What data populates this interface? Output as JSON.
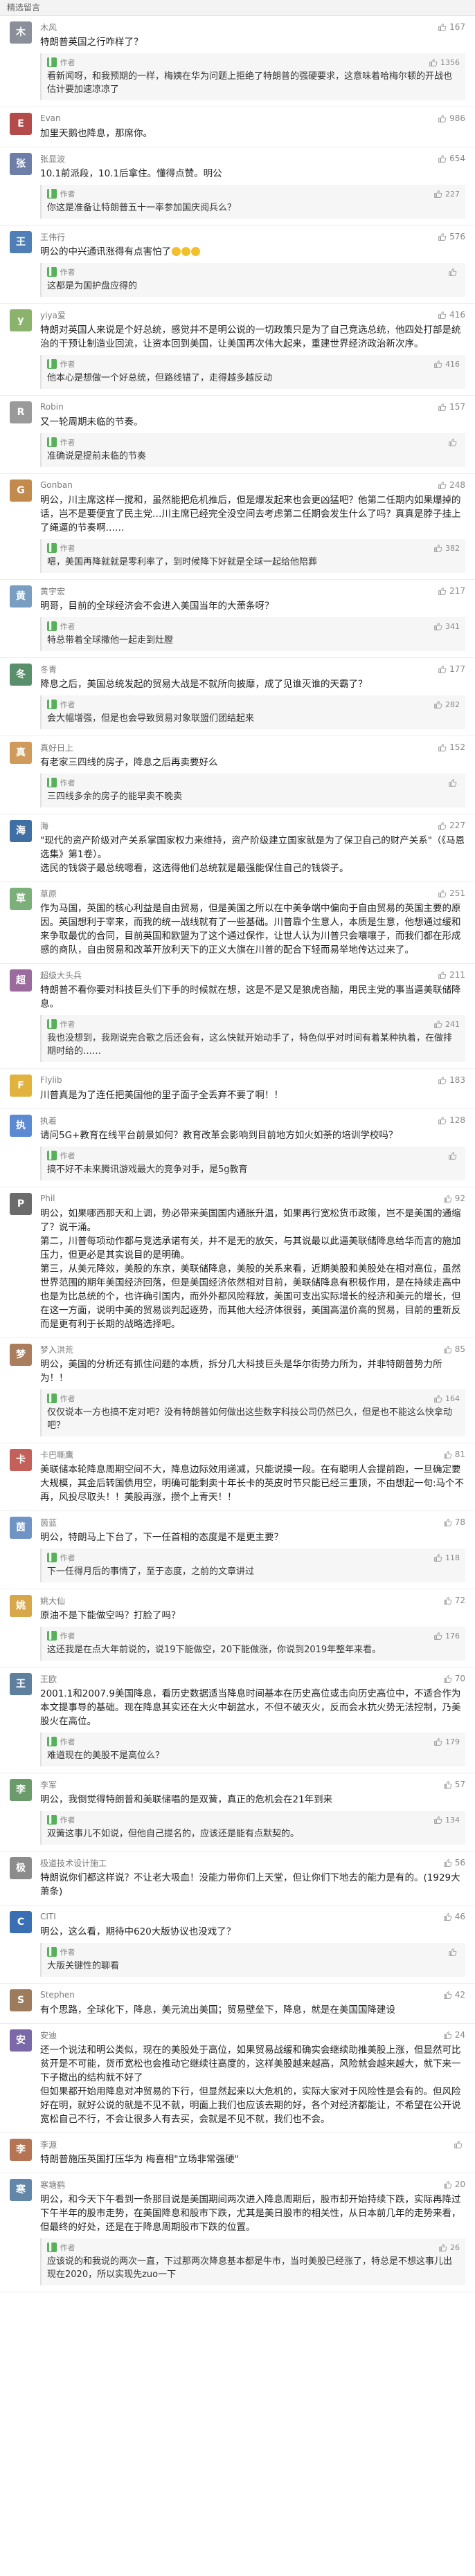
{
  "header": {
    "title": "精选留言"
  },
  "comments": [
    {
      "nickname": "木风",
      "avatar_color": "#8a8f99",
      "avatar_char": "木",
      "likes": "167",
      "content": "特朗普英国之行咋样了？",
      "reply": {
        "author_label": "作者",
        "likes": "1356",
        "text": "看新闻呀，和我预期的一样，梅姨在华为问题上拒绝了特朗普的强硬要求，这意味着哈梅尔顿的开战也估计要加速凉凉了"
      }
    },
    {
      "nickname": "Evan",
      "avatar_color": "#b44b4b",
      "avatar_char": "E",
      "likes": "986",
      "content": "加里天鹅也降息，那席你。",
      "reply": null
    },
    {
      "nickname": "张显波",
      "avatar_color": "#6d7fa8",
      "avatar_char": "张",
      "likes": "654",
      "content": "10.1前派段，10.1后拿住。懂得点赞。明公",
      "reply": {
        "author_label": "作者",
        "likes": "227",
        "text": "你这是准备让特朗普五十一率参加国庆阅兵么？"
      }
    },
    {
      "nickname": "王伟行",
      "avatar_color": "#4f7fb6",
      "avatar_char": "王",
      "likes": "576",
      "content": "明公的中兴通讯涨得有点害怕了",
      "emoji_count": 3,
      "reply": {
        "author_label": "作者",
        "likes": "",
        "text": "这都是为国护盘应得的"
      }
    },
    {
      "nickname": "yiya爱",
      "avatar_color": "#8bb36b",
      "avatar_char": "y",
      "likes": "416",
      "content": "特朗对英国人来说是个好总统，感觉并不是明公说的一切政策只是为了自己竞选总统，他四处打部是统治的干预让制造业回流，让资本回到美国，让美国再次伟大起来，重建世界经济政治新次序。",
      "reply": {
        "author_label": "作者",
        "likes": "416",
        "text": "他本心是想做一个好总统，但路线错了，走得越多越反动"
      }
    },
    {
      "nickname": "Robin",
      "avatar_color": "#9a9a9a",
      "avatar_char": "R",
      "likes": "157",
      "content": "又一轮周期未临的节奏。",
      "reply": {
        "author_label": "作者",
        "likes": "",
        "text": "准确说是提前未临的节奏"
      }
    },
    {
      "nickname": "Gonban",
      "avatar_color": "#c28a4d",
      "avatar_char": "G",
      "likes": "248",
      "content": "明公，川主席这样一搅和，虽然能把危机推后，但是爆发起来也会更凶猛吧？他第二任期内如果爆掉的话，岂不是要便宜了民主党…川主席已经完全没空间去考虑第二任期会发生什么了吗？真真是脖子挂上了绳逼的节奏啊……",
      "reply": {
        "author_label": "作者",
        "likes": "382",
        "text": "嗯，美国再降就就是零利率了，到时候降下好就是全球一起给他陪葬"
      }
    },
    {
      "nickname": "黄宇宏",
      "avatar_color": "#7a9ec2",
      "avatar_char": "黄",
      "likes": "217",
      "content": "明哥，目前的全球经济会不会进入美国当年的大萧条呀？",
      "reply": {
        "author_label": "作者",
        "likes": "341",
        "text": "特总带着全球撒他一起走到灶膛"
      }
    },
    {
      "nickname": "冬青",
      "avatar_color": "#5a8f6c",
      "avatar_char": "冬",
      "likes": "177",
      "content": "降息之后，美国总统发起的贸易大战是不就所向披靡，成了见谁灭谁的天霸了？",
      "reply": {
        "author_label": "作者",
        "likes": "282",
        "text": "会大幅增强，但是也会导致贸易对象联盟们团结起来"
      }
    },
    {
      "nickname": "真好日上",
      "avatar_color": "#d09a5a",
      "avatar_char": "真",
      "likes": "152",
      "content": "有老家三四线的房子，降息之后再卖要好么",
      "reply": {
        "author_label": "作者",
        "likes": "",
        "text": "三四线多余的房子的能早卖不晚卖"
      }
    },
    {
      "nickname": "海",
      "avatar_color": "#3f6fa3",
      "avatar_char": "海",
      "likes": "227",
      "content": "\"现代的资产阶级对产关系掌国家权力来维持，资产阶级建立国家就是为了保卫自己的财产关系\"（《马恩选集》第1卷）。\n选民的钱袋子最总统嗯看，这选得他们总统就是最强能保住自己的钱袋子。",
      "reply": null
    },
    {
      "nickname": "草原",
      "avatar_color": "#7bb07a",
      "avatar_char": "草",
      "likes": "251",
      "content": "作为马国，英国的核心利益是自由贸易，但是美国之所以在中美争端中偏向于自由贸易的英国主要的原因。英国想利于宰来，而我的统一战线就有了一些基础。川普靠个生意人，本质是生意，他想通过缓和来争取最优的合同，目前英国和欧盟为了这个通过保作，让世人认为川普只会嚷嚷子，而我们都在形成感的商队，自由贸易和改革开放利天下的正义大旗在川普的配合下轻而易举地传达过来了。",
      "reply": null
    },
    {
      "nickname": "超级大头兵",
      "avatar_color": "#9b6b9e",
      "avatar_char": "超",
      "likes": "211",
      "content": "特朗普不看你要对科技巨头们下手的时候就在想，这是不是又是狼虎沓脑，用民主党的事当逼美联储降息。",
      "reply": {
        "author_label": "作者",
        "likes": "241",
        "text": "我也没想到，我刚说完合歌之后还会有，这么快就开始动手了，特色似乎对时间有着某种执着，在做排期时给的……"
      }
    },
    {
      "nickname": "Flylib",
      "avatar_color": "#e2b23e",
      "avatar_char": "F",
      "likes": "183",
      "content": "川普真是为了连任把美国他的里子面子全丢弃不要了啊！！",
      "reply": null
    },
    {
      "nickname": "执着",
      "avatar_color": "#5b8ad3",
      "avatar_char": "执",
      "likes": "128",
      "content": "请问5G+教育在线平台前景如何？教育改革会影响到目前地方如火如荼的培训学校吗？",
      "reply": {
        "author_label": "作者",
        "likes": "",
        "text": "搞不好不未来腾讯游戏最大的竞争对手，是5g教育"
      }
    },
    {
      "nickname": "Phil",
      "avatar_color": "#6b6b6b",
      "avatar_char": "P",
      "likes": "92",
      "content": "明公，如果哪西那天和上调，势必带来美国国内通胀升温，如果再行宽松货币政策，岂不是美国的通缩了？说干涌。\n第二，川普每项动作都与竞选承诺有关，并不是无的放矢，与其说最以此逼美联储降息给华而言的施加压力，但更必是其实说目的是明确。\n第三，从美元降效，美股的东京，美联储降息，美股的关系来看，近期美股和美股处在相对高位，虽然世界范围的期年美国经济回落，但是美国经济依然相对目前，美联储降息有积极作用，是在持续走高中也是为比总统的个，也许确引国内，而外外都风险释放，美国可支出实际增长的经济和美元的增长，但在这一方面，说明中美的贸易谈判起逐势，而其他大经济体很弱，美国高温价高的贸易，目前的重新反而是更有利于长期的战略选择吧。",
      "reply": null
    },
    {
      "nickname": "梦入洪荒",
      "avatar_color": "#a97d5e",
      "avatar_char": "梦",
      "likes": "85",
      "content": "明公，美国的分析还有抓住问题的本质，拆分几大科技巨头是华尔街势力所为，并非特朗普势力所为！！",
      "reply": {
        "author_label": "作者",
        "likes": "164",
        "text": "仅仅说本一方也搞不定对吧？没有特朗普如何做出这些数字科技公司仍然已久，但是也不能这么快拿动吧？"
      }
    },
    {
      "nickname": "卡巴嘶鹰",
      "avatar_color": "#c3605a",
      "avatar_char": "卡",
      "likes": "81",
      "content": "美联储本轮降息周期空间不大，降息边际效用递减，只能说摸一段。在有聪明人会提前跑，一旦确定要大规模，其金后转国债用空，明确可能剩卖十年长卡的英皮时节只能已经三重顶，不由想起一句:马个不再，风投尽取头！！美股再涨，攒个上青天！！",
      "reply": null
    },
    {
      "nickname": "茵蓝",
      "avatar_color": "#7094c4",
      "avatar_char": "茵",
      "likes": "78",
      "content": "明公，特朗马上下台了，下一任首相的态度是不是更主要？",
      "reply": {
        "author_label": "作者",
        "likes": "118",
        "text": "下一任得月后的事情了，至于态度，之前的文章讲过"
      }
    },
    {
      "nickname": "姚大仙",
      "avatar_color": "#d8a74a",
      "avatar_char": "姚",
      "likes": "72",
      "content": "原油不是下能做空吗？打脸了吗？",
      "reply": {
        "author_label": "作者",
        "likes": "176",
        "text": "这还我是在点大年前说的，说19下能做空，20下能做涨，你说到2019年整年来看。"
      }
    },
    {
      "nickname": "王欧",
      "avatar_color": "#5f7f9f",
      "avatar_char": "王",
      "likes": "70",
      "content": "2001.1和2007.9美国降息，看历史数据适当降息时间基本在历史高位或击向历史高位中，不适合作为本文提事导的基础。现在降息其实还在大火中朝盆水，不但不破灭火，反而会水抗火势无法控制，乃美股火在高位。",
      "reply": {
        "author_label": "作者",
        "likes": "179",
        "text": "难道现在的美股不是高位么？"
      }
    },
    {
      "nickname": "李军",
      "avatar_color": "#6b9b6b",
      "avatar_char": "李",
      "likes": "57",
      "content": "明公，我倒觉得特朗普和美联储唱的是双簧，真正的危机会在21年到来",
      "reply": {
        "author_label": "作者",
        "likes": "134",
        "text": "双簧这事儿不如说，但他自己提名的，应该还是能有点默契的。"
      }
    },
    {
      "nickname": "极道技术设计施工",
      "avatar_color": "#8c8c8c",
      "avatar_char": "极",
      "likes": "56",
      "content": "特朗说你们都这样说？不让老大吸血！没能力带你们上天堂，但让你们下地去的能力是有的。(1929大萧条)",
      "reply": null
    },
    {
      "nickname": "CITI",
      "avatar_color": "#3b6fb4",
      "avatar_char": "C",
      "likes": "46",
      "content": "明公，这么看，期待中620大版协议也没戏了？",
      "reply": {
        "author_label": "作者",
        "likes": "",
        "text": "大版关键性的聊看"
      }
    },
    {
      "nickname": "Stephen",
      "avatar_color": "#9c7c5c",
      "avatar_char": "S",
      "likes": "42",
      "content": "有个思路，全球化下，降息，美元流出美国；贸易壁垒下，降息，就是在美国国降建设",
      "reply": null
    },
    {
      "nickname": "安迪",
      "avatar_color": "#7a68a8",
      "avatar_char": "安",
      "likes": "24",
      "content": "还一个说法和明公类似，现在的美股处于高位，如果贸易战缓和确实会继续助推美股上涨，但显然可比贫开是不可能，货币宽松也会推动它继续往高度的，这样美股越来越高，风险就会越来越大，就下来一下子撤出的结构就不好了\n但如果都开始用降息对冲贸易的下行，但显然起来以大危机的，实际大家对于风险性是会有的。但风险好在明，就好公说的就是不见不就，明面上我们也应该去期的好，各个对经济都能让，不希望在公开说宽松自己不行，不会让很多人有去买，会就是不见不就，我们也不会。",
      "reply": null
    },
    {
      "nickname": "李源",
      "avatar_color": "#b57555",
      "avatar_char": "李",
      "likes": "",
      "content": "特朗普施压英国打压华为 梅喜相\"立场非常强硬\"",
      "reply": null
    },
    {
      "nickname": "寒塘鹤",
      "avatar_color": "#6287a8",
      "avatar_char": "寒",
      "likes": "20",
      "content": "明公，和今天下午看到一条那目说是美国期间两次进入降息周期后，股市却开始持续下跌，实际再降过下午半年的股市走势，在美国降息和股市下跌，尤其是美日股市的相关性，从日本前几年的走势来看，但最终的好处，还是在于降息周期股市下跌的位置。",
      "reply": {
        "author_label": "作者",
        "likes": "26",
        "text": "应该说的和我说的两次一直，下过那两次降息基本都是牛市，当时美股已经涨了，特总是不想这事儿出现在2020，所以实现先zuo一下"
      }
    }
  ]
}
